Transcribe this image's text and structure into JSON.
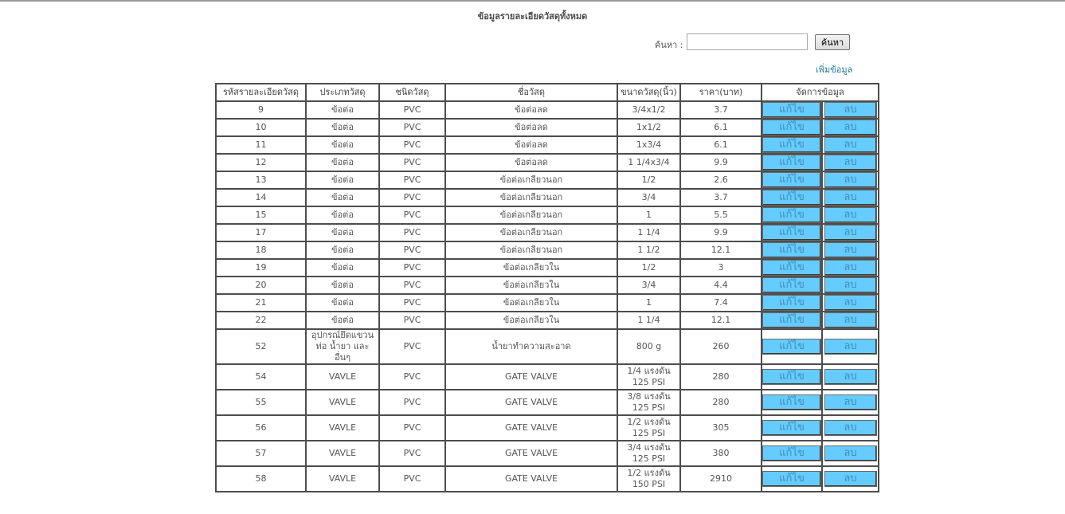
{
  "page": {
    "title": "ข้อมูลรายละเอียดวัสดุทั้งหมด"
  },
  "search": {
    "label": "ค้นหา :",
    "value": "",
    "placeholder": "",
    "button_label": "ค้นหา"
  },
  "add_link": "เพิ่มข้อมูล",
  "table": {
    "headers": [
      "รหัสรายละเอียดวัสดุ",
      "ประเภทวัสดุ",
      "ชนิดวัสดุ",
      "ชื่อวัสดุ",
      "ขนาดวัสดุ(นิ้ว)",
      "ราคา(บาท)",
      "จัดการข้อมูล"
    ],
    "edit_label": "แก้ไข",
    "delete_label": "ลบ",
    "rows": [
      {
        "id": "9",
        "category": "ข้อต่อ",
        "type": "PVC",
        "name": "ข้อต่อลด",
        "size": "3/4x1/2",
        "price": "3.7"
      },
      {
        "id": "10",
        "category": "ข้อต่อ",
        "type": "PVC",
        "name": "ข้อต่อลด",
        "size": "1x1/2",
        "price": "6.1"
      },
      {
        "id": "11",
        "category": "ข้อต่อ",
        "type": "PVC",
        "name": "ข้อต่อลด",
        "size": "1x3/4",
        "price": "6.1"
      },
      {
        "id": "12",
        "category": "ข้อต่อ",
        "type": "PVC",
        "name": "ข้อต่อลด",
        "size": "1 1/4x3/4",
        "price": "9.9"
      },
      {
        "id": "13",
        "category": "ข้อต่อ",
        "type": "PVC",
        "name": "ข้อต่อเกลียวนอก",
        "size": "1/2",
        "price": "2.6"
      },
      {
        "id": "14",
        "category": "ข้อต่อ",
        "type": "PVC",
        "name": "ข้อต่อเกลียวนอก",
        "size": "3/4",
        "price": "3.7"
      },
      {
        "id": "15",
        "category": "ข้อต่อ",
        "type": "PVC",
        "name": "ข้อต่อเกลียวนอก",
        "size": "1",
        "price": "5.5"
      },
      {
        "id": "17",
        "category": "ข้อต่อ",
        "type": "PVC",
        "name": "ข้อต่อเกลียวนอก",
        "size": "1 1/4",
        "price": "9.9"
      },
      {
        "id": "18",
        "category": "ข้อต่อ",
        "type": "PVC",
        "name": "ข้อต่อเกลียวนอก",
        "size": "1 1/2",
        "price": "12.1"
      },
      {
        "id": "19",
        "category": "ข้อต่อ",
        "type": "PVC",
        "name": "ข้อต่อเกลียวใน",
        "size": "1/2",
        "price": "3"
      },
      {
        "id": "20",
        "category": "ข้อต่อ",
        "type": "PVC",
        "name": "ข้อต่อเกลียวใน",
        "size": "3/4",
        "price": "4.4"
      },
      {
        "id": "21",
        "category": "ข้อต่อ",
        "type": "PVC",
        "name": "ข้อต่อเกลียวใน",
        "size": "1",
        "price": "7.4"
      },
      {
        "id": "22",
        "category": "ข้อต่อ",
        "type": "PVC",
        "name": "ข้อต่อเกลียวใน",
        "size": "1 1/4",
        "price": "12.1"
      },
      {
        "id": "52",
        "category": "อุปกรณ์ยึดแขวนท่อ น้ำยา และอื่นๆ",
        "type": "PVC",
        "name": "น้ำยาทำความสะอาด",
        "size": "800 g",
        "price": "260"
      },
      {
        "id": "54",
        "category": "VAVLE",
        "type": "PVC",
        "name": "GATE VALVE",
        "size": "1/4 แรงดัน 125 PSI",
        "price": "280"
      },
      {
        "id": "55",
        "category": "VAVLE",
        "type": "PVC",
        "name": "GATE VALVE",
        "size": "3/8 แรงดัน 125 PSI",
        "price": "280"
      },
      {
        "id": "56",
        "category": "VAVLE",
        "type": "PVC",
        "name": "GATE VALVE",
        "size": "1/2 แรงดัน 125 PSI",
        "price": "305"
      },
      {
        "id": "57",
        "category": "VAVLE",
        "type": "PVC",
        "name": "GATE VALVE",
        "size": "3/4 แรงดัน 125 PSI",
        "price": "380"
      },
      {
        "id": "58",
        "category": "VAVLE",
        "type": "PVC",
        "name": "GATE VALVE",
        "size": "1/2 แรงดัน 150 PSI",
        "price": "2910"
      }
    ]
  },
  "colors": {
    "action_button_bg": "#66ccff",
    "action_button_text": "#3d8fb8",
    "link": "#1a7a9a",
    "table_border": "#4d4d4d"
  }
}
